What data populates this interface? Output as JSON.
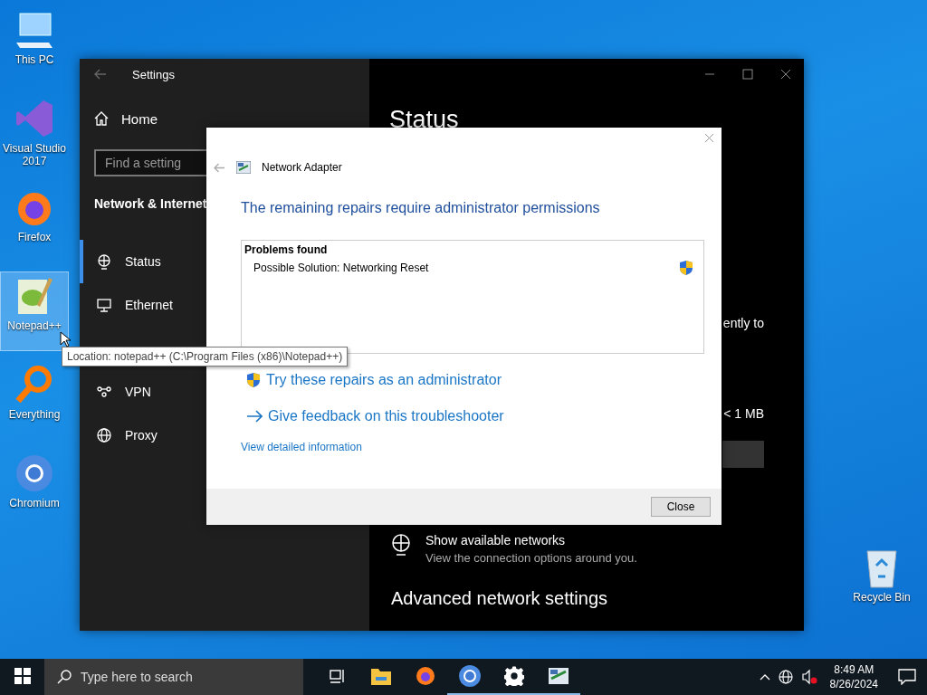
{
  "desktop_icons": [
    {
      "kind": "pc",
      "label": "This PC",
      "selected": false
    },
    {
      "kind": "vs",
      "label": "Visual Studio 2017",
      "selected": false
    },
    {
      "kind": "firefox",
      "label": "Firefox",
      "selected": false
    },
    {
      "kind": "notepad",
      "label": "Notepad++",
      "selected": true
    },
    {
      "kind": "everything",
      "label": "Everything",
      "selected": false
    },
    {
      "kind": "chromium",
      "label": "Chromium",
      "selected": false
    }
  ],
  "recycle_bin": {
    "label": "Recycle Bin"
  },
  "settings": {
    "title": "Settings",
    "home": "Home",
    "search": {
      "placeholder": "Find a setting"
    },
    "section": "Network & Internet",
    "nav": [
      {
        "kind": "status",
        "label": "Status",
        "selected": true
      },
      {
        "kind": "ethernet",
        "label": "Ethernet",
        "selected": false
      },
      {
        "kind": "dialup",
        "selected": false
      },
      {
        "kind": "vpn",
        "label": "VPN",
        "selected": false
      },
      {
        "kind": "proxy",
        "label": "Proxy",
        "selected": false
      }
    ],
    "content": {
      "heading": "Status",
      "fragment_1": "ently to",
      "fragment_2": "< 1 MB",
      "show_networks": {
        "title": "Show available networks",
        "subtitle": "View the connection options around you."
      },
      "advanced": "Advanced network settings"
    }
  },
  "dialog": {
    "title": "Network Adapter",
    "heading": "The remaining repairs require administrator permissions",
    "problems_header": "Problems found",
    "problem": "Possible Solution: Networking Reset",
    "links": [
      {
        "kind": "admin",
        "label": "Try these repairs as an administrator"
      },
      {
        "kind": "feedback",
        "label": "Give feedback on this troubleshooter"
      }
    ],
    "detail_link": "View detailed information",
    "close_button": "Close"
  },
  "tooltip": "Location: notepad++ (C:\\Program Files (x86)\\Notepad++)",
  "taskbar": {
    "search": {
      "placeholder": "Type here to search"
    },
    "apps": [
      {
        "kind": "taskview",
        "running": false
      },
      {
        "kind": "explorer",
        "running": false
      },
      {
        "kind": "firefox",
        "running": false
      },
      {
        "kind": "chromium",
        "running": true
      },
      {
        "kind": "settings",
        "running": true
      },
      {
        "kind": "adapter",
        "running": true
      }
    ],
    "time": "8:49 AM",
    "date": "8/26/2024"
  }
}
